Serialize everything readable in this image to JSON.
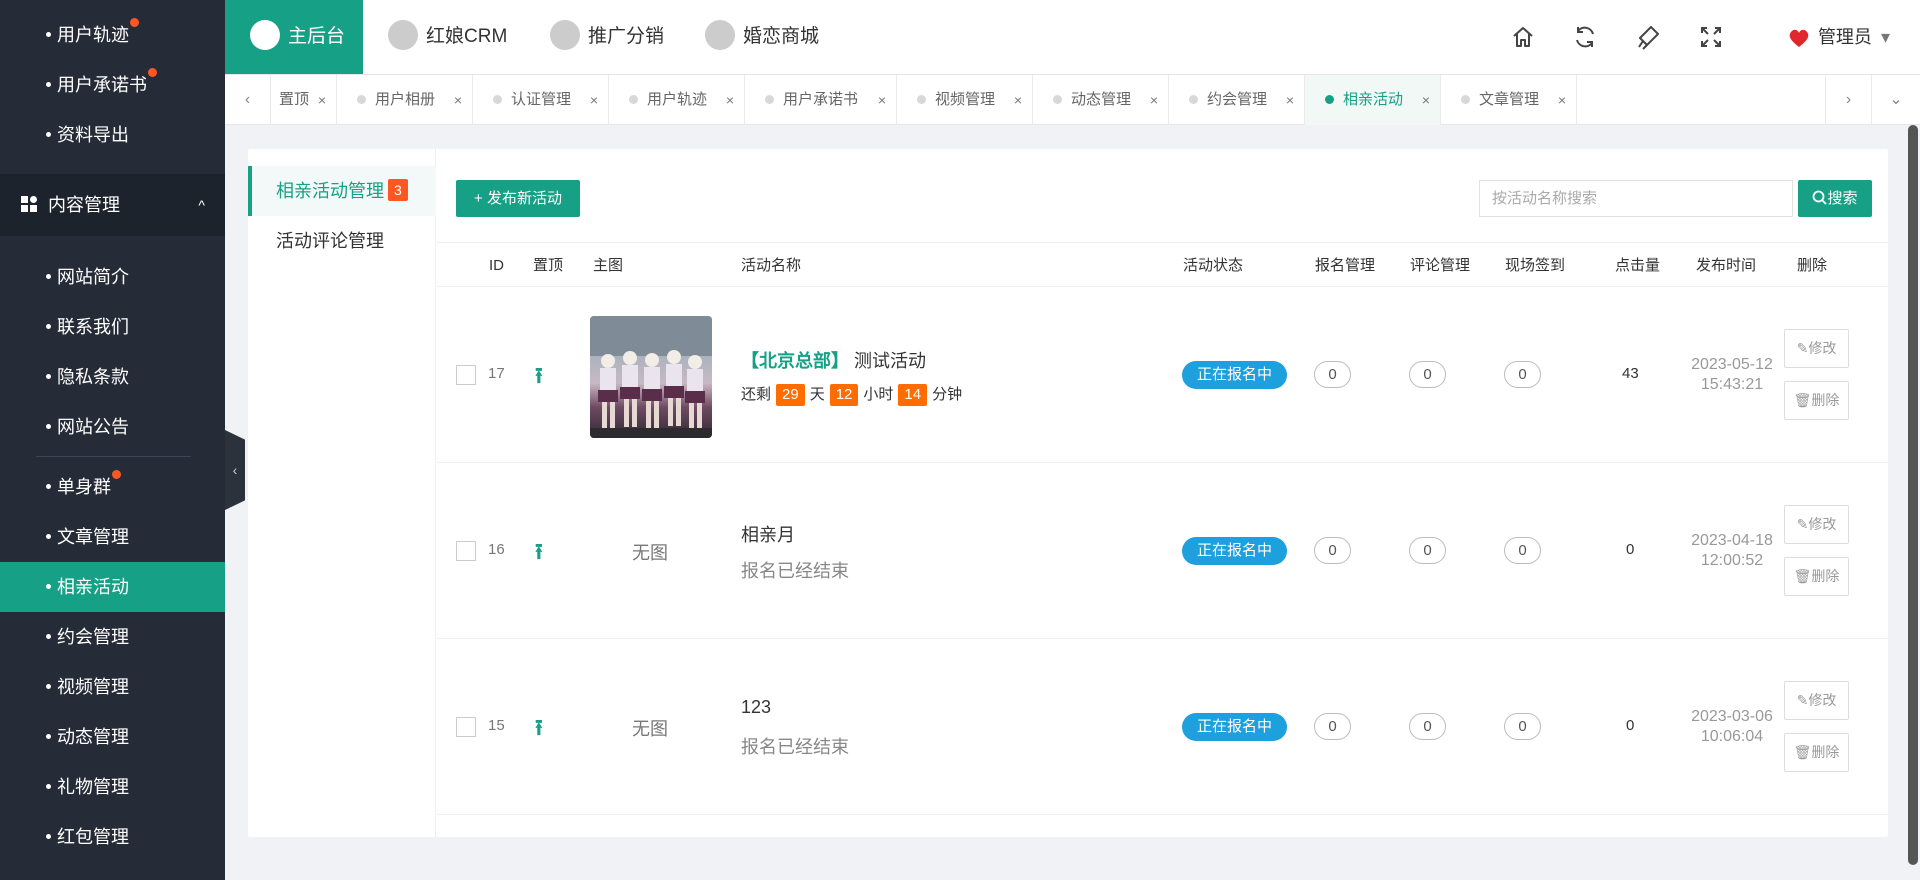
{
  "sidebar": {
    "top_items": [
      {
        "label": "用户轨迹",
        "red_dot": true
      },
      {
        "label": "用户承诺书",
        "red_dot": true
      },
      {
        "label": "资料导出",
        "red_dot": false
      }
    ],
    "section": {
      "label": "内容管理",
      "chevron": "^"
    },
    "items": [
      {
        "label": "网站简介",
        "red_dot": false
      },
      {
        "label": "联系我们",
        "red_dot": false
      },
      {
        "label": "隐私条款",
        "red_dot": false
      },
      {
        "label": "网站公告",
        "red_dot": false
      },
      {
        "label": "单身群",
        "red_dot": true
      },
      {
        "label": "文章管理",
        "red_dot": false
      },
      {
        "label": "相亲活动",
        "red_dot": false,
        "active": true
      },
      {
        "label": "约会管理",
        "red_dot": false
      },
      {
        "label": "视频管理",
        "red_dot": false
      },
      {
        "label": "动态管理",
        "red_dot": false
      },
      {
        "label": "礼物管理",
        "red_dot": false
      },
      {
        "label": "红包管理",
        "red_dot": false
      }
    ],
    "collapse_icon": "‹"
  },
  "header": {
    "tabs": [
      {
        "label": "主后台",
        "active": true
      },
      {
        "label": "红娘CRM",
        "active": false
      },
      {
        "label": "推广分销",
        "active": false
      },
      {
        "label": "婚恋商城",
        "active": false
      }
    ],
    "admin_label": "管理员",
    "admin_caret": "▾",
    "icons": [
      "home-icon",
      "refresh-icon",
      "clear-cache-icon",
      "fullscreen-icon"
    ]
  },
  "tabstrip": {
    "prev": "‹",
    "next": "›",
    "more": "⌄",
    "close": "×",
    "tabs": [
      {
        "label": "置顶",
        "active": false
      },
      {
        "label": "用户相册",
        "active": false
      },
      {
        "label": "认证管理",
        "active": false
      },
      {
        "label": "用户轨迹",
        "active": false
      },
      {
        "label": "用户承诺书",
        "active": false
      },
      {
        "label": "视频管理",
        "active": false
      },
      {
        "label": "动态管理",
        "active": false
      },
      {
        "label": "约会管理",
        "active": false
      },
      {
        "label": "相亲活动",
        "active": true
      },
      {
        "label": "文章管理",
        "active": false
      }
    ]
  },
  "subnav": {
    "items": [
      {
        "label": "相亲活动管理",
        "badge": "3",
        "active": true
      },
      {
        "label": "活动评论管理",
        "active": false
      }
    ]
  },
  "toolbar": {
    "publish_label": "+ 发布新活动",
    "search_placeholder": "按活动名称搜索",
    "search_value": "",
    "search_label": "搜索"
  },
  "table": {
    "headers": [
      "ID",
      "置顶",
      "主图",
      "活动名称",
      "活动状态",
      "报名管理",
      "评论管理",
      "现场签到",
      "点击量",
      "发布时间",
      "删除"
    ],
    "pin_glyph": "⭱",
    "edit_label": "修改",
    "delete_label": "删除",
    "rows": [
      {
        "id": "17",
        "has_image": true,
        "no_image_text": "",
        "name_prefix": "【北京总部】",
        "name": "测试活动",
        "countdown": {
          "prefix": "还剩",
          "days": "29",
          "days_unit": "天",
          "hours": "12",
          "hours_unit": "小时",
          "minutes": "14",
          "minutes_unit": "分钟"
        },
        "subtext": "",
        "status": "正在报名中",
        "signups": "0",
        "comments": "0",
        "checkins": "0",
        "hits": "43",
        "date": "2023-05-12",
        "time": "15:43:21"
      },
      {
        "id": "16",
        "has_image": false,
        "no_image_text": "无图",
        "name_prefix": "",
        "name": "相亲月",
        "subtext": "报名已经结束",
        "status": "正在报名中",
        "signups": "0",
        "comments": "0",
        "checkins": "0",
        "hits": "0",
        "date": "2023-04-18",
        "time": "12:00:52"
      },
      {
        "id": "15",
        "has_image": false,
        "no_image_text": "无图",
        "name_prefix": "",
        "name": "123",
        "subtext": "报名已经结束",
        "status": "正在报名中",
        "signups": "0",
        "comments": "0",
        "checkins": "0",
        "hits": "0",
        "date": "2023-03-06",
        "time": "10:06:04"
      }
    ]
  },
  "colors": {
    "accent": "#16a085",
    "sidebar_bg": "#262c37",
    "status_blue": "#1e9fde",
    "badge_red": "#ff5722",
    "countdown_orange": "#ff6d00"
  }
}
